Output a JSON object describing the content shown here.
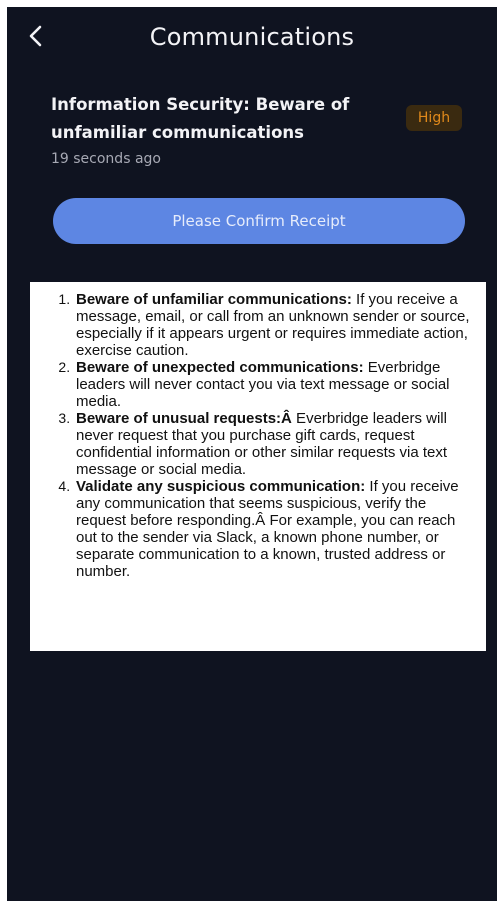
{
  "header": {
    "back_icon": "chevron-left-icon",
    "title": "Communications"
  },
  "alert": {
    "title": "Information Security: Beware of unfamiliar communications",
    "priority": "High",
    "priority_color": "#e0891b",
    "timestamp": "19 seconds ago"
  },
  "actions": {
    "confirm_label": "Please Confirm Receipt",
    "confirm_color": "#5d86e3"
  },
  "body": {
    "items": [
      {
        "heading": "Beware of unfamiliar communications:",
        "text": " If you receive a message, email, or call from an unknown sender or source, especially if it appears urgent or requires immediate action, exercise caution."
      },
      {
        "heading": "Beware of unexpected communications:",
        "text": " Everbridge leaders will never contact you via text message or social media."
      },
      {
        "heading": "Beware of unusual requests:Â",
        "text": "  Everbridge leaders will never request that you purchase gift cards, request confidential information or other similar requests via text message or social media."
      },
      {
        "heading": "Validate any suspicious communication:",
        "text": " If you receive any communication that seems suspicious, verify the request before responding.Â  For example, you can reach out to the sender via Slack, a known phone number, or separate communication to a known, trusted address or number."
      }
    ]
  },
  "colors": {
    "background": "#0f1320",
    "text_primary": "#f3f3f6",
    "text_secondary": "#a7a9b4"
  }
}
